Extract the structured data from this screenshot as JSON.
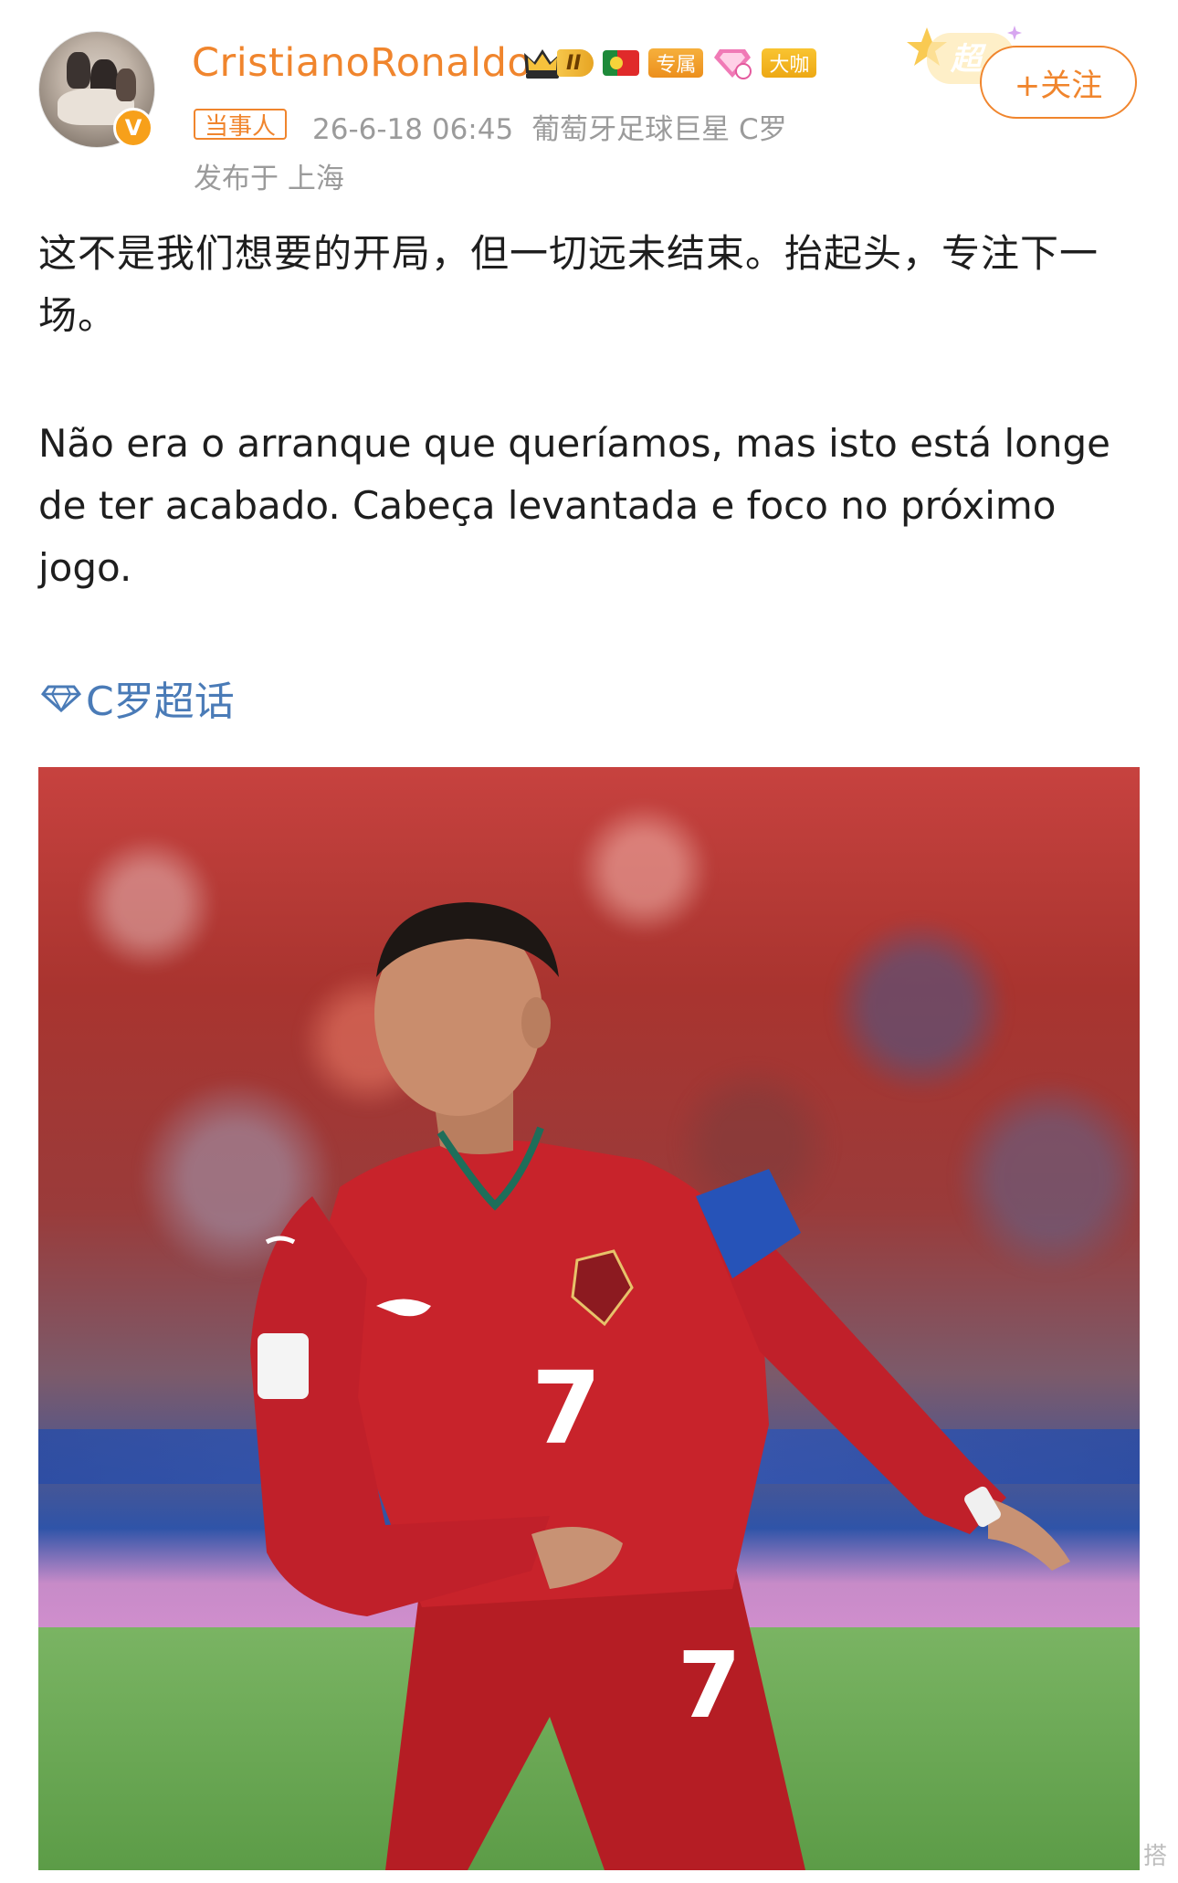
{
  "author": {
    "name": "CristianoRonaldo",
    "rank_numeral": "II",
    "badge_exclusive": "专属",
    "badge_vip": "大咖",
    "verified_mark": "V",
    "brand_color": "#f0852d"
  },
  "post_meta": {
    "identity_tag": "当事人",
    "timestamp": "26-6-18 06:45",
    "source": "葡萄牙足球巨星 C罗",
    "location": "发布于 上海"
  },
  "actions": {
    "follow_label": "+关注",
    "super_label": "超"
  },
  "content": {
    "text_zh": "这不是我们想要的开局，但一切远未结束。抬起头，专注下一场。",
    "text_pt": "Não era o arranque que queríamos, mas isto está longe de ter acabado. Cabeça levantada e foco no próximo jogo.",
    "topic_label": "C罗超话",
    "topic_icon": "diamond-topic-icon",
    "link_color": "#4a7bb7"
  },
  "photo": {
    "jersey_number": "7",
    "edge_mark": "搭"
  }
}
